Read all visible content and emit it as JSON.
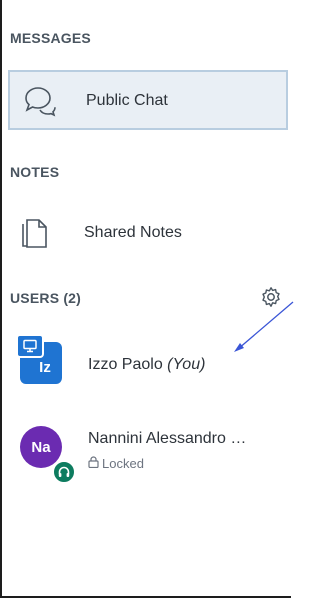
{
  "sections": {
    "messages": "MESSAGES",
    "notes": "NOTES",
    "users": "USERS (2)"
  },
  "messages": {
    "public_chat": {
      "label": "Public Chat",
      "icon": "chat-bubbles-icon"
    }
  },
  "notes": {
    "shared_notes": {
      "label": "Shared Notes",
      "icon": "document-icon"
    }
  },
  "users": {
    "settings_icon": "gear-icon",
    "list": [
      {
        "initials": "Iz",
        "name": "Izzo Paolo",
        "suffix": "(You)",
        "role": "presenter",
        "avatar_color": "#1f74d2"
      },
      {
        "initials": "Na",
        "name": "Nannini Alessandro …",
        "status": "Locked",
        "audio": "headset",
        "avatar_color": "#6b2bb1"
      }
    ]
  },
  "colors": {
    "selected_background": "#e9eff5",
    "selected_border": "#b8cde0",
    "annotation_arrow": "#3a55d6"
  }
}
